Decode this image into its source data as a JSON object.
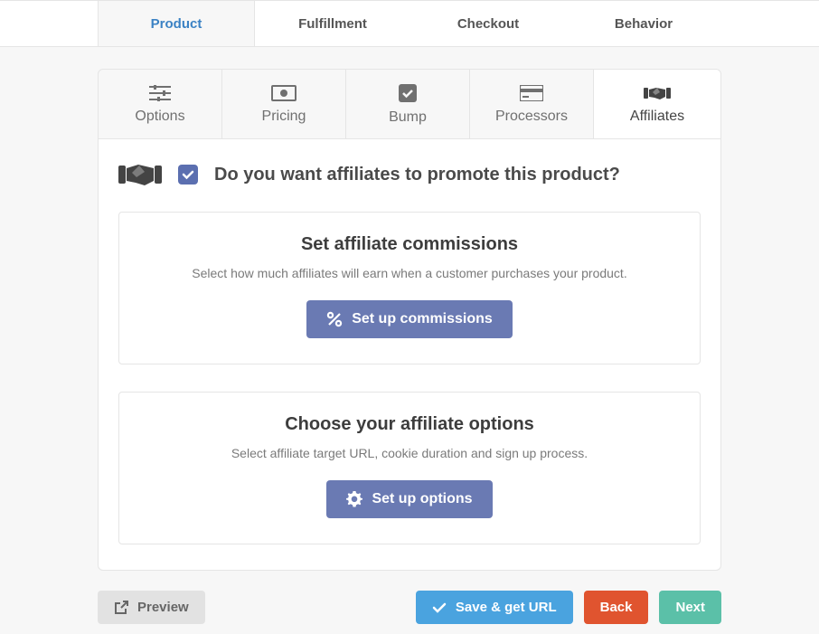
{
  "top_tabs": {
    "product": "Product",
    "fulfillment": "Fulfillment",
    "checkout": "Checkout",
    "behavior": "Behavior"
  },
  "sub_tabs": {
    "options": "Options",
    "pricing": "Pricing",
    "bump": "Bump",
    "processors": "Processors",
    "affiliates": "Affiliates"
  },
  "question": "Do you want affiliates to promote this product?",
  "affiliates_enabled": true,
  "cards": {
    "commissions": {
      "title": "Set affiliate commissions",
      "desc": "Select how much affiliates will earn when a customer purchases your product.",
      "button": "Set up commissions"
    },
    "options": {
      "title": "Choose your affiliate options",
      "desc": "Select affiliate target URL, cookie duration and sign up process.",
      "button": "Set up options"
    }
  },
  "footer": {
    "preview": "Preview",
    "save": "Save & get URL",
    "back": "Back",
    "next": "Next"
  }
}
